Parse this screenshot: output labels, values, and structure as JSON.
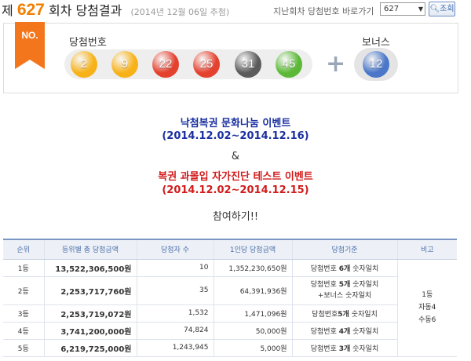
{
  "header": {
    "title_prefix": "제",
    "draw_number": "627",
    "title_suffix": "회차 당첨결과",
    "draw_date": "(2014년 12월 06일 추첨)",
    "nav_label": "지난회차 당첨번호 바로가기",
    "selected_round": "627",
    "search_label": "조회"
  },
  "winning": {
    "badge": "NO.",
    "numbers_label": "당첨번호",
    "numbers": [
      "2",
      "9",
      "22",
      "25",
      "31",
      "45"
    ],
    "bonus_label": "보너스",
    "bonus": "12",
    "plus_symbol": "+"
  },
  "colors": {
    "ball_yellow": "#f7b21a",
    "ball_red": "#e4412f",
    "ball_gray": "#5b5b5b",
    "ball_green": "#5cb937",
    "ball_blue": "#4a77c9",
    "ribbon": "#f3761c"
  },
  "events": {
    "event1_title": "낙첨복권 문화나눔 이벤트",
    "event1_period": "(2014.12.02~2014.12.16)",
    "amp": "&",
    "event2_title": "복권 과몰입 자가진단 테스트 이벤트",
    "event2_period": "(2014.12.02~2014.12.15)",
    "join": "참여하기!!"
  },
  "table": {
    "headers": [
      "순위",
      "등위별 총 당첨금액",
      "당첨자 수",
      "1인당 당첨금액",
      "당첨기준",
      "비고"
    ],
    "rows": [
      {
        "rank": "1등",
        "total": "13,522,306,500원",
        "winners": "10",
        "per_person": "1,352,230,650원",
        "criteria_a": "당첨번호 ",
        "criteria_b": "6개",
        "criteria_c": " 숫자일치",
        "criteria_d": ""
      },
      {
        "rank": "2등",
        "total": "2,253,717,760원",
        "winners": "35",
        "per_person": "64,391,936원",
        "criteria_a": "당첨번호 ",
        "criteria_b": "5개",
        "criteria_c": " 숫자일치",
        "criteria_d": "+보너스 숫자일치"
      },
      {
        "rank": "3등",
        "total": "2,253,719,072원",
        "winners": "1,532",
        "per_person": "1,471,096원",
        "criteria_a": "당첨번호",
        "criteria_b": "5개",
        "criteria_c": " 숫자일치",
        "criteria_d": ""
      },
      {
        "rank": "4등",
        "total": "3,741,200,000원",
        "winners": "74,824",
        "per_person": "50,000원",
        "criteria_a": "당첨번호 ",
        "criteria_b": "4개",
        "criteria_c": " 숫자일치",
        "criteria_d": ""
      },
      {
        "rank": "5등",
        "total": "6,219,725,000원",
        "winners": "1,243,945",
        "per_person": "5,000원",
        "criteria_a": "당첨번호 ",
        "criteria_b": "3개",
        "criteria_c": " 숫자일치",
        "criteria_d": ""
      }
    ],
    "note_line1": "1등",
    "note_line2": "자동4",
    "note_line3": "수동6"
  }
}
